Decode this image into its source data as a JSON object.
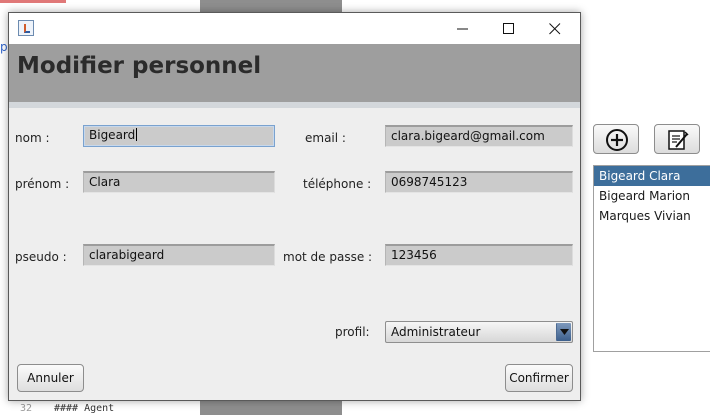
{
  "background": {
    "left_edge_glyph": "p",
    "code": {
      "line_number": "32",
      "text": "#### Agent"
    },
    "add_icon": "plus-circle-icon",
    "edit_icon": "edit-note-icon",
    "user_list": [
      {
        "label": "Bigeard Clara",
        "selected": true
      },
      {
        "label": "Bigeard Marion",
        "selected": false
      },
      {
        "label": "Marques Vivian",
        "selected": false
      }
    ]
  },
  "dialog": {
    "icons": {
      "app": "java-app-icon",
      "minimize": "minimize-icon",
      "maximize": "maximize-icon",
      "close": "close-icon"
    },
    "header_title": "Modifier personnel",
    "colors": {
      "header": "#9e9e9e",
      "selection": "#3d6e9b",
      "field": "#cbcbcb"
    },
    "form": {
      "nom": {
        "label": "nom :",
        "value": "Bigeard"
      },
      "email": {
        "label": "email :",
        "value": "clara.bigeard@gmail.com"
      },
      "prenom": {
        "label": "prénom :",
        "value": "Clara"
      },
      "telephone": {
        "label": "téléphone :",
        "value": "0698745123"
      },
      "pseudo": {
        "label": "pseudo :",
        "value": "clarabigeard"
      },
      "mot_de_passe": {
        "label": "mot de passe :",
        "value": "123456"
      },
      "profil": {
        "label": "profil:",
        "value": "Administrateur"
      }
    },
    "buttons": {
      "cancel": "Annuler",
      "confirm": "Confirmer"
    }
  }
}
